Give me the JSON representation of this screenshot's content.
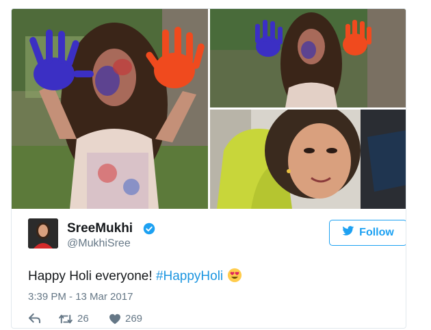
{
  "tweet": {
    "author": {
      "name": "SreeMukhi",
      "handle": "@MukhiSree",
      "verified": true
    },
    "follow_label": "Follow",
    "text_prefix": "Happy Holi everyone! ",
    "hashtag": "#HappyHoli",
    "emoji_icon": "heart-eyes-emoji-icon",
    "timestamp": "3:39 PM - 13 Mar 2017",
    "retweet_count": "26",
    "like_count": "269"
  },
  "colors": {
    "brand_blue": "#1da1f2",
    "hashtag_blue": "#1b95e0",
    "muted_text": "#657786"
  },
  "icons": {
    "verified": "verified-badge-icon",
    "follow": "twitter-bird-icon",
    "reply": "reply-icon",
    "retweet": "retweet-icon",
    "like": "heart-icon"
  }
}
